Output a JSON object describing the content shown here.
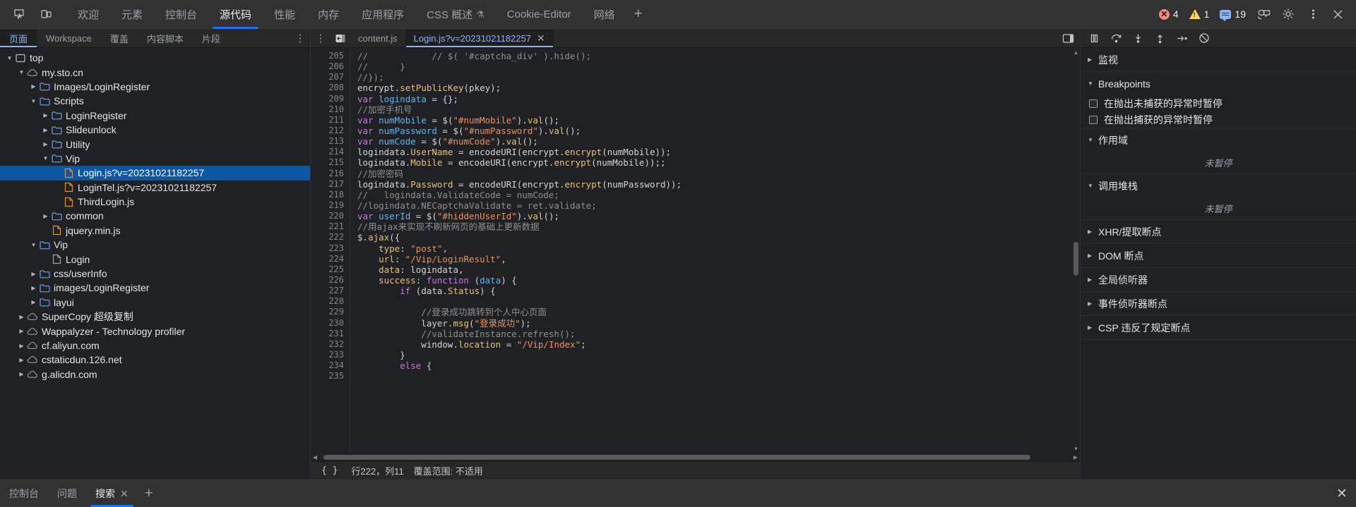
{
  "topbar": {
    "inspect_icon": "inspect-element-icon",
    "device_icon": "device-toolbar-icon",
    "tabs": [
      {
        "label": "欢迎",
        "active": false,
        "flask": false
      },
      {
        "label": "元素",
        "active": false,
        "flask": false
      },
      {
        "label": "控制台",
        "active": false,
        "flask": false
      },
      {
        "label": "源代码",
        "active": true,
        "flask": false
      },
      {
        "label": "性能",
        "active": false,
        "flask": false
      },
      {
        "label": "内存",
        "active": false,
        "flask": false
      },
      {
        "label": "应用程序",
        "active": false,
        "flask": false
      },
      {
        "label": "CSS 概述",
        "active": false,
        "flask": true
      },
      {
        "label": "Cookie-Editor",
        "active": false,
        "flask": false
      },
      {
        "label": "网络",
        "active": false,
        "flask": false
      }
    ],
    "add_tab_label": "+",
    "counters": {
      "error_count": "4",
      "warning_count": "1",
      "info_count": "19"
    },
    "accent_color": "#1a73e8",
    "error_color": "#f28b82",
    "warning_color": "#fdd663",
    "info_color": "#8ab4f8",
    "settings_icon": "gear-icon",
    "more_icon": "more-vertical-icon",
    "close_icon": "close-icon",
    "cast_icon": "devices-icon"
  },
  "navigator": {
    "tabs": [
      {
        "label": "页面",
        "active": true
      },
      {
        "label": "Workspace",
        "active": false
      },
      {
        "label": "覆盖",
        "active": false
      },
      {
        "label": "内容脚本",
        "active": false
      },
      {
        "label": "片段",
        "active": false
      }
    ],
    "more_label": "⋮",
    "tree": [
      {
        "label": "top",
        "indent": 0,
        "arrow": "down",
        "icon": "frame",
        "selected": false
      },
      {
        "label": "my.sto.cn",
        "indent": 1,
        "arrow": "down",
        "icon": "cloud",
        "selected": false
      },
      {
        "label": "Images/LoginRegister",
        "indent": 2,
        "arrow": "right",
        "icon": "folder",
        "selected": false
      },
      {
        "label": "Scripts",
        "indent": 2,
        "arrow": "down",
        "icon": "folder",
        "selected": false
      },
      {
        "label": "LoginRegister",
        "indent": 3,
        "arrow": "right",
        "icon": "folder",
        "selected": false
      },
      {
        "label": "Slideunlock",
        "indent": 3,
        "arrow": "right",
        "icon": "folder",
        "selected": false
      },
      {
        "label": "Utility",
        "indent": 3,
        "arrow": "right",
        "icon": "folder",
        "selected": false
      },
      {
        "label": "Vip",
        "indent": 3,
        "arrow": "down",
        "icon": "folder",
        "selected": false
      },
      {
        "label": "Login.js?v=20231021182257",
        "indent": 4,
        "arrow": "none",
        "icon": "js-file",
        "selected": true
      },
      {
        "label": "LoginTel.js?v=20231021182257",
        "indent": 4,
        "arrow": "none",
        "icon": "js-file",
        "selected": false
      },
      {
        "label": "ThirdLogin.js",
        "indent": 4,
        "arrow": "none",
        "icon": "js-file",
        "selected": false
      },
      {
        "label": "common",
        "indent": 3,
        "arrow": "right",
        "icon": "folder",
        "selected": false
      },
      {
        "label": "jquery.min.js",
        "indent": 3,
        "arrow": "none",
        "icon": "js-file",
        "selected": false
      },
      {
        "label": "Vip",
        "indent": 2,
        "arrow": "down",
        "icon": "folder",
        "selected": false
      },
      {
        "label": "Login",
        "indent": 3,
        "arrow": "none",
        "icon": "doc-file",
        "selected": false
      },
      {
        "label": "css/userInfo",
        "indent": 2,
        "arrow": "right",
        "icon": "folder",
        "selected": false
      },
      {
        "label": "images/LoginRegister",
        "indent": 2,
        "arrow": "right",
        "icon": "folder",
        "selected": false
      },
      {
        "label": "layui",
        "indent": 2,
        "arrow": "right",
        "icon": "folder",
        "selected": false
      },
      {
        "label": "SuperCopy 超级复制",
        "indent": 1,
        "arrow": "right",
        "icon": "cloud",
        "selected": false
      },
      {
        "label": "Wappalyzer - Technology profiler",
        "indent": 1,
        "arrow": "right",
        "icon": "cloud",
        "selected": false
      },
      {
        "label": "cf.aliyun.com",
        "indent": 1,
        "arrow": "right",
        "icon": "cloud",
        "selected": false
      },
      {
        "label": "cstaticdun.126.net",
        "indent": 1,
        "arrow": "right",
        "icon": "cloud",
        "selected": false
      },
      {
        "label": "g.alicdn.com",
        "indent": 1,
        "arrow": "right",
        "icon": "cloud",
        "selected": false
      }
    ]
  },
  "editor": {
    "more_label": "⋮",
    "back_icon": "jump-to-previous-icon",
    "tabs": [
      {
        "label": "content.js",
        "active": false,
        "closable": false
      },
      {
        "label": "Login.js?v=20231021182257",
        "active": true,
        "closable": true,
        "close_label": "✕"
      }
    ],
    "panel_toggle_icon": "show-debugger-icon",
    "first_line": 205,
    "lines": [
      {
        "n": 205,
        "tokens": [
          {
            "t": "//            // $( '#captcha_div' ).hide();",
            "c": "c-com"
          }
        ]
      },
      {
        "n": 206,
        "tokens": [
          {
            "t": "//      }",
            "c": "c-com"
          }
        ]
      },
      {
        "n": 207,
        "tokens": [
          {
            "t": "//});",
            "c": "c-com"
          }
        ]
      },
      {
        "n": 208,
        "tokens": [
          {
            "t": "encrypt.",
            "c": "c-pln"
          },
          {
            "t": "setPublicKey",
            "c": "c-fn"
          },
          {
            "t": "(pkey);",
            "c": "c-pln"
          }
        ]
      },
      {
        "n": 209,
        "tokens": [
          {
            "t": "var ",
            "c": "c-kw"
          },
          {
            "t": "logindata",
            "c": "c-var"
          },
          {
            "t": " = {};",
            "c": "c-pln"
          }
        ]
      },
      {
        "n": 210,
        "tokens": [
          {
            "t": "//加密手机号",
            "c": "c-com"
          }
        ]
      },
      {
        "n": 211,
        "tokens": [
          {
            "t": "var ",
            "c": "c-kw"
          },
          {
            "t": "numMobile",
            "c": "c-var"
          },
          {
            "t": " = $(",
            "c": "c-pln"
          },
          {
            "t": "\"#numMobile\"",
            "c": "c-str"
          },
          {
            "t": ").",
            "c": "c-pln"
          },
          {
            "t": "val",
            "c": "c-fn"
          },
          {
            "t": "();",
            "c": "c-pln"
          }
        ]
      },
      {
        "n": 212,
        "tokens": [
          {
            "t": "var ",
            "c": "c-kw"
          },
          {
            "t": "numPassword",
            "c": "c-var"
          },
          {
            "t": " = $(",
            "c": "c-pln"
          },
          {
            "t": "\"#numPassword\"",
            "c": "c-str"
          },
          {
            "t": ").",
            "c": "c-pln"
          },
          {
            "t": "val",
            "c": "c-fn"
          },
          {
            "t": "();",
            "c": "c-pln"
          }
        ]
      },
      {
        "n": 213,
        "tokens": [
          {
            "t": "var ",
            "c": "c-kw"
          },
          {
            "t": "numCode",
            "c": "c-var"
          },
          {
            "t": " = $(",
            "c": "c-pln"
          },
          {
            "t": "\"#numCode\"",
            "c": "c-str"
          },
          {
            "t": ").",
            "c": "c-pln"
          },
          {
            "t": "val",
            "c": "c-fn"
          },
          {
            "t": "();",
            "c": "c-pln"
          }
        ]
      },
      {
        "n": 214,
        "tokens": [
          {
            "t": "logindata.",
            "c": "c-pln"
          },
          {
            "t": "UserName",
            "c": "c-prop"
          },
          {
            "t": " = encodeURI(encrypt.",
            "c": "c-pln"
          },
          {
            "t": "encrypt",
            "c": "c-fn"
          },
          {
            "t": "(numMobile));",
            "c": "c-pln"
          }
        ]
      },
      {
        "n": 215,
        "tokens": [
          {
            "t": "logindata.",
            "c": "c-pln"
          },
          {
            "t": "Mobile",
            "c": "c-prop"
          },
          {
            "t": " = encodeURI(encrypt.",
            "c": "c-pln"
          },
          {
            "t": "encrypt",
            "c": "c-fn"
          },
          {
            "t": "(numMobile));;",
            "c": "c-pln"
          }
        ]
      },
      {
        "n": 216,
        "tokens": [
          {
            "t": "//加密密码",
            "c": "c-com"
          }
        ]
      },
      {
        "n": 217,
        "tokens": [
          {
            "t": "logindata.",
            "c": "c-pln"
          },
          {
            "t": "Password",
            "c": "c-prop"
          },
          {
            "t": " = encodeURI(encrypt.",
            "c": "c-pln"
          },
          {
            "t": "encrypt",
            "c": "c-fn"
          },
          {
            "t": "(numPassword));",
            "c": "c-pln"
          }
        ]
      },
      {
        "n": 218,
        "tokens": [
          {
            "t": "//   logindata.ValidateCode = numCode;",
            "c": "c-com"
          }
        ]
      },
      {
        "n": 219,
        "tokens": [
          {
            "t": "//logindata.NECaptchaValidate = ret.validate;",
            "c": "c-com"
          }
        ]
      },
      {
        "n": 220,
        "tokens": [
          {
            "t": "var ",
            "c": "c-kw"
          },
          {
            "t": "userId",
            "c": "c-var"
          },
          {
            "t": " = $(",
            "c": "c-pln"
          },
          {
            "t": "\"#hiddenUserId\"",
            "c": "c-str"
          },
          {
            "t": ").",
            "c": "c-pln"
          },
          {
            "t": "val",
            "c": "c-fn"
          },
          {
            "t": "();",
            "c": "c-pln"
          }
        ]
      },
      {
        "n": 221,
        "tokens": [
          {
            "t": "//用ajax来实现不刷新网页的基础上更新数据",
            "c": "c-com"
          }
        ]
      },
      {
        "n": 222,
        "tokens": [
          {
            "t": "$.",
            "c": "c-pln"
          },
          {
            "t": "ajax",
            "c": "c-fn"
          },
          {
            "t": "({",
            "c": "c-pln"
          }
        ]
      },
      {
        "n": 223,
        "tokens": [
          {
            "t": "    ",
            "c": "c-pln"
          },
          {
            "t": "type",
            "c": "c-prop"
          },
          {
            "t": ": ",
            "c": "c-pln"
          },
          {
            "t": "\"post\"",
            "c": "c-str"
          },
          {
            "t": ",",
            "c": "c-pln"
          }
        ]
      },
      {
        "n": 224,
        "tokens": [
          {
            "t": "    ",
            "c": "c-pln"
          },
          {
            "t": "url",
            "c": "c-prop"
          },
          {
            "t": ": ",
            "c": "c-pln"
          },
          {
            "t": "\"/Vip/LoginResult\"",
            "c": "c-str"
          },
          {
            "t": ",",
            "c": "c-pln"
          }
        ]
      },
      {
        "n": 225,
        "tokens": [
          {
            "t": "    ",
            "c": "c-pln"
          },
          {
            "t": "data",
            "c": "c-prop"
          },
          {
            "t": ": logindata,",
            "c": "c-pln"
          }
        ]
      },
      {
        "n": 226,
        "tokens": [
          {
            "t": "    ",
            "c": "c-pln"
          },
          {
            "t": "success",
            "c": "c-prop"
          },
          {
            "t": ": ",
            "c": "c-pln"
          },
          {
            "t": "function ",
            "c": "c-kw"
          },
          {
            "t": "(",
            "c": "c-pln"
          },
          {
            "t": "data",
            "c": "c-var"
          },
          {
            "t": ") {",
            "c": "c-pln"
          }
        ]
      },
      {
        "n": 227,
        "tokens": [
          {
            "t": "        ",
            "c": "c-pln"
          },
          {
            "t": "if",
            "c": "c-kw"
          },
          {
            "t": " (data.",
            "c": "c-pln"
          },
          {
            "t": "Status",
            "c": "c-prop"
          },
          {
            "t": ") {",
            "c": "c-pln"
          }
        ]
      },
      {
        "n": 228,
        "tokens": [
          {
            "t": "",
            "c": "c-pln"
          }
        ]
      },
      {
        "n": 229,
        "tokens": [
          {
            "t": "            //登录成功跳转到个人中心页面",
            "c": "c-com"
          }
        ]
      },
      {
        "n": 230,
        "tokens": [
          {
            "t": "            layer.",
            "c": "c-pln"
          },
          {
            "t": "msg",
            "c": "c-fn"
          },
          {
            "t": "(",
            "c": "c-pln"
          },
          {
            "t": "\"登录成功\"",
            "c": "c-str"
          },
          {
            "t": ");",
            "c": "c-pln"
          }
        ]
      },
      {
        "n": 231,
        "tokens": [
          {
            "t": "            //validateInstance.refresh();",
            "c": "c-com"
          }
        ]
      },
      {
        "n": 232,
        "tokens": [
          {
            "t": "            window.",
            "c": "c-pln"
          },
          {
            "t": "location",
            "c": "c-prop"
          },
          {
            "t": " = ",
            "c": "c-pln"
          },
          {
            "t": "\"/Vip/Index\"",
            "c": "c-str"
          },
          {
            "t": ";",
            "c": "c-pln"
          }
        ]
      },
      {
        "n": 233,
        "tokens": [
          {
            "t": "        }",
            "c": "c-pln"
          }
        ]
      },
      {
        "n": 234,
        "tokens": [
          {
            "t": "        ",
            "c": "c-pln"
          },
          {
            "t": "else",
            "c": "c-kw"
          },
          {
            "t": " {",
            "c": "c-pln"
          }
        ]
      },
      {
        "n": 235,
        "tokens": [
          {
            "t": "",
            "c": "c-pln"
          }
        ]
      }
    ],
    "status": {
      "pretty_print_label": "{ }",
      "cursor_position": "行222，列11",
      "coverage": "覆盖范围: 不适用"
    }
  },
  "debugger": {
    "toolbar": [
      {
        "icon": "pause-resume-icon",
        "name": "pause-script-execution"
      },
      {
        "icon": "step-over-icon",
        "name": "step-over-next-function-call"
      },
      {
        "icon": "step-into-icon",
        "name": "step-into-next-function-call"
      },
      {
        "icon": "step-out-icon",
        "name": "step-out-of-current-function"
      },
      {
        "icon": "step-icon",
        "name": "step"
      },
      {
        "icon": "deactivate-breakpoints-icon",
        "name": "deactivate-breakpoints"
      }
    ],
    "sections": [
      {
        "title": "监视",
        "expanded": false,
        "kind": "watch"
      },
      {
        "title": "Breakpoints",
        "expanded": true,
        "kind": "breakpoints",
        "checkboxes": [
          {
            "label": "在抛出未捕获的异常时暂停",
            "checked": false
          },
          {
            "label": "在抛出捕获的异常时暂停",
            "checked": false
          }
        ]
      },
      {
        "title": "作用域",
        "expanded": true,
        "kind": "scope",
        "empty_text": "未暂停"
      },
      {
        "title": "调用堆栈",
        "expanded": true,
        "kind": "callstack",
        "empty_text": "未暂停"
      },
      {
        "title": "XHR/提取断点",
        "expanded": false,
        "kind": "xhr"
      },
      {
        "title": "DOM 断点",
        "expanded": false,
        "kind": "dom"
      },
      {
        "title": "全局侦听器",
        "expanded": false,
        "kind": "global-listeners"
      },
      {
        "title": "事件侦听器断点",
        "expanded": false,
        "kind": "event-listener"
      },
      {
        "title": "CSP 违反了规定断点",
        "expanded": false,
        "kind": "csp"
      }
    ]
  },
  "drawer": {
    "tabs": [
      {
        "label": "控制台",
        "active": false,
        "closable": false
      },
      {
        "label": "问题",
        "active": false,
        "closable": false
      },
      {
        "label": "搜索",
        "active": true,
        "closable": true,
        "close_label": "✕"
      }
    ],
    "add_label": "+",
    "close_label": "✕"
  }
}
